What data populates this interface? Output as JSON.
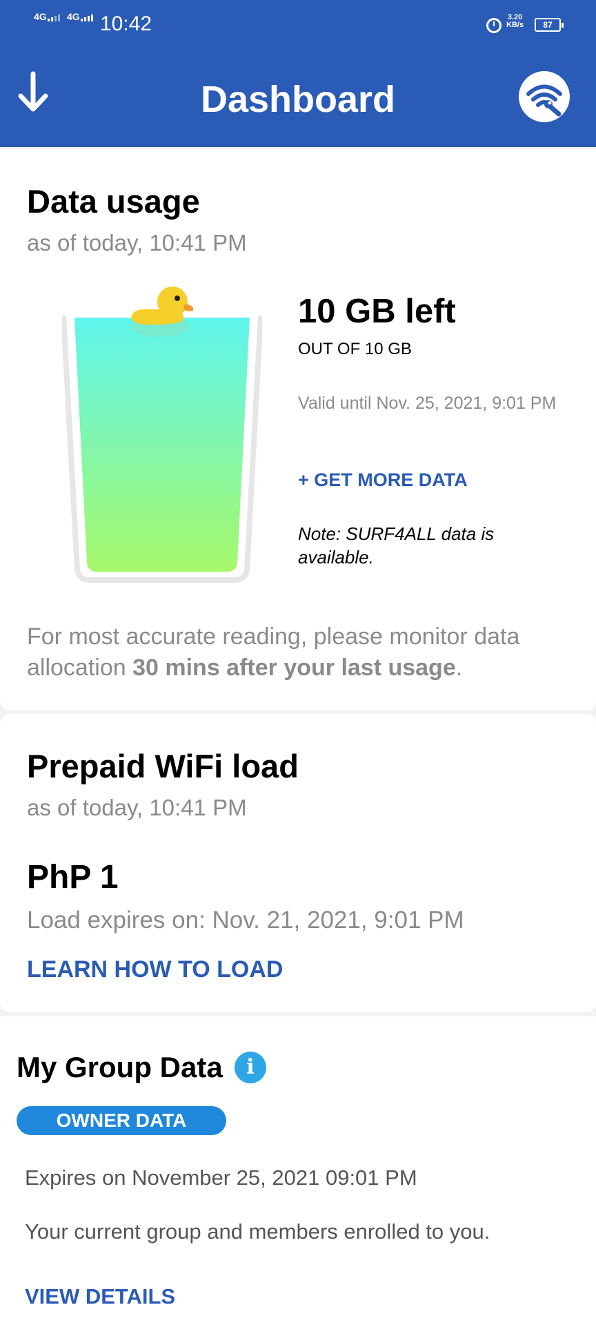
{
  "status_bar": {
    "network1": "4G",
    "network2": "4G",
    "time": "10:42",
    "speed_value": "3.20",
    "speed_unit": "KB/s",
    "battery": "87"
  },
  "header": {
    "title": "Dashboard",
    "left_icon": "down-arrow-icon",
    "right_icon": "wifi-wrench-icon"
  },
  "data_usage": {
    "title": "Data usage",
    "as_of": "as of today, 10:41 PM",
    "remaining": "10 GB left",
    "total": "OUT OF 10 GB",
    "valid_until": "Valid until Nov. 25, 2021, 9:01 PM",
    "get_more": "+ GET MORE DATA",
    "note": "Note: SURF4ALL data is available.",
    "fill_fraction": 1.0,
    "reading_prefix": "For most accurate reading, please monitor data allocation ",
    "reading_bold": "30 mins after your last usage",
    "reading_suffix": "."
  },
  "wifi_load": {
    "title": "Prepaid WiFi load",
    "as_of": "as of today, 10:41 PM",
    "amount": "PhP 1",
    "expires": "Load expires on: Nov. 21, 2021, 9:01 PM",
    "learn": "LEARN HOW TO LOAD"
  },
  "group_data": {
    "title": "My Group Data",
    "info_icon": "info-icon",
    "badge": "OWNER DATA",
    "expires": "Expires on November 25, 2021 09:01 PM",
    "description": "Your current group and members enrolled to you.",
    "view": "VIEW DETAILS"
  },
  "colors": {
    "header_blue": "#2a5bb6",
    "badge_blue": "#1f88dc",
    "info_blue": "#2fa6e6",
    "cup_top": "#5ff5ee",
    "cup_bottom": "#a6f86a",
    "duck_yellow": "#f7cf2a"
  }
}
